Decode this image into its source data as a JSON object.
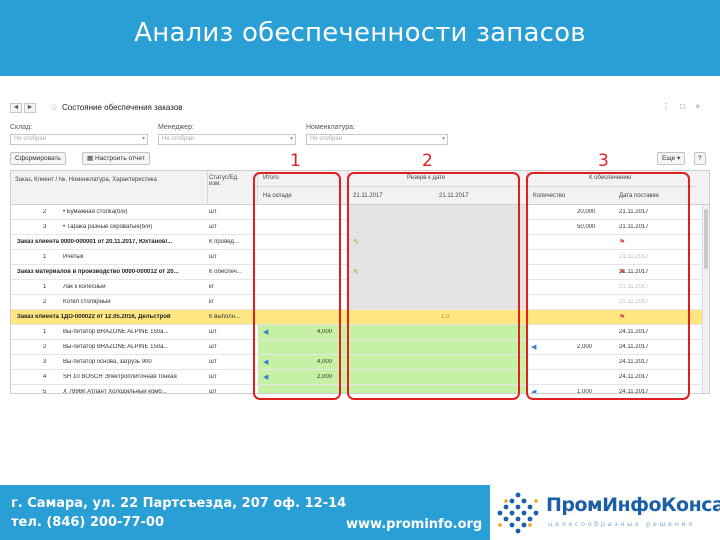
{
  "slide": {
    "title": "Анализ обеспеченности запасов",
    "footer_address": "г. Самара, ул. 22 Партсъезда, 207 оф. 12-14",
    "footer_phone": "тел. (846) 200-77-00",
    "footer_site": "www.prominfo.org",
    "logo_name": "ПромИнфоКонсалт",
    "logo_tagline": "целесообразные решения"
  },
  "window": {
    "back": "◄",
    "forward": "►",
    "title": "Состояние обеспечения заказов",
    "controls": "⋮ □ ×"
  },
  "filters": {
    "warehouse_label": "Склад:",
    "warehouse_placeholder": "Не отобран",
    "manager_label": "Менеджер:",
    "manager_placeholder": "Не отобран",
    "item_label": "Номенклатура:",
    "item_placeholder": "Не отобран"
  },
  "toolbar": {
    "refresh": "Сформировать",
    "settings": "Настроить отчет",
    "more": "Еще ▾",
    "help": "?"
  },
  "grid_header": {
    "col_order": "Заказ, Клиент / №, Номенклатура, Характеристика",
    "col_status": "Статус/Ед. изм.",
    "total_label": "Итого",
    "on_hand_label": "На складе",
    "reserve_label": "Резерв к дате",
    "reserve_date1": "21.11.2017",
    "reserve_date2": "21.11.2017",
    "to_provide_label": "К обеспечению",
    "qty_label": "Количество",
    "arrival_label": "Дата поставки"
  },
  "rows": [
    {
      "num": "2",
      "name": "• Бумажная столка(б/и)",
      "unit": "шт",
      "type": "plain",
      "qty": "20,000",
      "date": "21.11.2017",
      "green": false
    },
    {
      "num": "3",
      "name": "• Тарака разные сероватые(б/и)",
      "unit": "шт",
      "type": "plain",
      "qty": "50,000",
      "date": "21.11.2017",
      "green": false
    },
    {
      "num": "",
      "name": "Заказ клиента 0000-000001 от 20.11.2017, Юхтанов/...",
      "unit": "К провед...",
      "type": "group",
      "qty": "",
      "date": "",
      "green": false
    },
    {
      "num": "1",
      "name": "Ичетык",
      "unit": "шт",
      "type": "plain",
      "qty": "",
      "date": "21.11.2017",
      "green": false
    },
    {
      "num": "",
      "name": "Заказ материалов в производство 0000-000012 от 20...",
      "unit": "К обеспеч...",
      "type": "group",
      "qty": "",
      "date": "21.11.2017",
      "green": false
    },
    {
      "num": "1",
      "name": "Лак к колесный",
      "unit": "кг",
      "type": "plain",
      "qty": "",
      "date": "21.11.2017",
      "green": false
    },
    {
      "num": "2",
      "name": "Котел столярный",
      "unit": "кг",
      "type": "plain",
      "qty": "",
      "date": "21.11.2017",
      "green": false
    },
    {
      "num": "",
      "name": "Заказ клиента 1ДО-000022 от 12.05.2016, Дельстрой",
      "unit": "К выполн...",
      "type": "yellow",
      "qty": "",
      "date": "",
      "green": false
    },
    {
      "num": "1",
      "name": "Вы-питатор BRAZONE ALPINE 150а...",
      "unit": "шт",
      "type": "plain",
      "onhand": "4,000",
      "qty": "",
      "date": "24.11.2017",
      "green": true
    },
    {
      "num": "2",
      "name": "Вы-питатор BRAZONE ALPINE 150а...",
      "unit": "шт",
      "type": "plain",
      "onhand": "",
      "qty": "2,000",
      "date": "24.11.2017",
      "green": true
    },
    {
      "num": "3",
      "name": "Вы-питатор основа, загрузь 900",
      "unit": "шт",
      "type": "plain",
      "onhand": "4,000",
      "qty": "",
      "date": "24.11.2017",
      "green": true
    },
    {
      "num": "4",
      "name": "SH 10 BOSCH Электроплиточная тонкая",
      "unit": "шт",
      "type": "plain",
      "onhand": "2,000",
      "qty": "",
      "date": "24.11.2017",
      "green": true
    },
    {
      "num": "5",
      "name": "Х 7896К Атлант Холодильный комб...",
      "unit": "шт",
      "type": "plain",
      "onhand": "",
      "qty": "1,000",
      "date": "24.11.2017",
      "green": true
    }
  ],
  "markers": {
    "box1": "1",
    "box2": "2",
    "box3": "3",
    "yellow_reserve": "1,0"
  },
  "colors": {
    "brand_blue": "#2a9fd6",
    "highlight_red": "#e02020",
    "row_yellow": "#ffe680",
    "cell_green": "#c6f1a4"
  }
}
